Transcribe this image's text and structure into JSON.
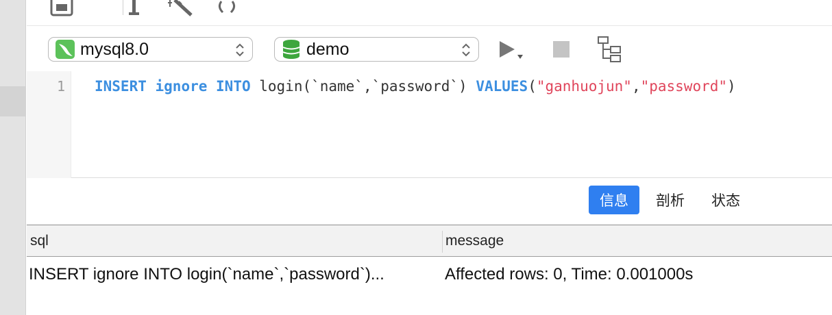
{
  "toolbar": {
    "icons": [
      "save-icon",
      "text-cursor-icon",
      "magic-wand-icon",
      "refresh-icon"
    ]
  },
  "connection": {
    "selected": "mysql8.0",
    "icon": "mysql-dolphin-icon",
    "icon_color": "#5cc25a"
  },
  "database": {
    "selected": "demo",
    "icon": "database-icon",
    "icon_color": "#3da63d"
  },
  "actions": {
    "run_icon": "play-icon",
    "stop_icon": "stop-icon",
    "explain_icon": "explain-tree-icon"
  },
  "editor": {
    "line_number": "1",
    "tokens": {
      "insert": "INSERT",
      "ignore": "ignore",
      "into": "INTO",
      "table": " login(`name`,`password`) ",
      "values": "VALUES",
      "open": "(",
      "str1": "\"ganhuojun\"",
      "comma": ",",
      "str2": "\"password\"",
      "close": ")"
    }
  },
  "tabs": {
    "info": "信息",
    "profile": "剖析",
    "status": "状态",
    "active": "info"
  },
  "results": {
    "columns": [
      "sql",
      "message"
    ],
    "rows": [
      {
        "sql": "INSERT ignore INTO login(`name`,`password`)...",
        "message": "Affected rows: 0, Time: 0.001000s"
      }
    ]
  },
  "colors": {
    "accent": "#2f7ff0",
    "keyword": "#3c8fe0",
    "string": "#e0455b"
  }
}
